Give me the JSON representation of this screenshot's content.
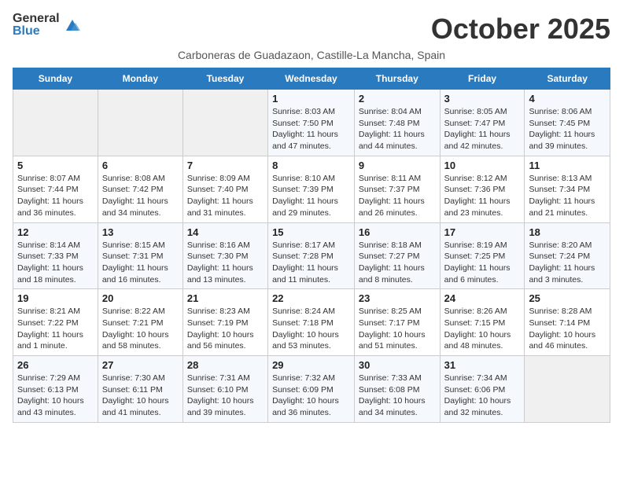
{
  "header": {
    "logo_general": "General",
    "logo_blue": "Blue",
    "month_title": "October 2025",
    "subtitle": "Carboneras de Guadazaon, Castille-La Mancha, Spain"
  },
  "weekdays": [
    "Sunday",
    "Monday",
    "Tuesday",
    "Wednesday",
    "Thursday",
    "Friday",
    "Saturday"
  ],
  "weeks": [
    [
      {
        "day": "",
        "info": ""
      },
      {
        "day": "",
        "info": ""
      },
      {
        "day": "",
        "info": ""
      },
      {
        "day": "1",
        "info": "Sunrise: 8:03 AM\nSunset: 7:50 PM\nDaylight: 11 hours and 47 minutes."
      },
      {
        "day": "2",
        "info": "Sunrise: 8:04 AM\nSunset: 7:48 PM\nDaylight: 11 hours and 44 minutes."
      },
      {
        "day": "3",
        "info": "Sunrise: 8:05 AM\nSunset: 7:47 PM\nDaylight: 11 hours and 42 minutes."
      },
      {
        "day": "4",
        "info": "Sunrise: 8:06 AM\nSunset: 7:45 PM\nDaylight: 11 hours and 39 minutes."
      }
    ],
    [
      {
        "day": "5",
        "info": "Sunrise: 8:07 AM\nSunset: 7:44 PM\nDaylight: 11 hours and 36 minutes."
      },
      {
        "day": "6",
        "info": "Sunrise: 8:08 AM\nSunset: 7:42 PM\nDaylight: 11 hours and 34 minutes."
      },
      {
        "day": "7",
        "info": "Sunrise: 8:09 AM\nSunset: 7:40 PM\nDaylight: 11 hours and 31 minutes."
      },
      {
        "day": "8",
        "info": "Sunrise: 8:10 AM\nSunset: 7:39 PM\nDaylight: 11 hours and 29 minutes."
      },
      {
        "day": "9",
        "info": "Sunrise: 8:11 AM\nSunset: 7:37 PM\nDaylight: 11 hours and 26 minutes."
      },
      {
        "day": "10",
        "info": "Sunrise: 8:12 AM\nSunset: 7:36 PM\nDaylight: 11 hours and 23 minutes."
      },
      {
        "day": "11",
        "info": "Sunrise: 8:13 AM\nSunset: 7:34 PM\nDaylight: 11 hours and 21 minutes."
      }
    ],
    [
      {
        "day": "12",
        "info": "Sunrise: 8:14 AM\nSunset: 7:33 PM\nDaylight: 11 hours and 18 minutes."
      },
      {
        "day": "13",
        "info": "Sunrise: 8:15 AM\nSunset: 7:31 PM\nDaylight: 11 hours and 16 minutes."
      },
      {
        "day": "14",
        "info": "Sunrise: 8:16 AM\nSunset: 7:30 PM\nDaylight: 11 hours and 13 minutes."
      },
      {
        "day": "15",
        "info": "Sunrise: 8:17 AM\nSunset: 7:28 PM\nDaylight: 11 hours and 11 minutes."
      },
      {
        "day": "16",
        "info": "Sunrise: 8:18 AM\nSunset: 7:27 PM\nDaylight: 11 hours and 8 minutes."
      },
      {
        "day": "17",
        "info": "Sunrise: 8:19 AM\nSunset: 7:25 PM\nDaylight: 11 hours and 6 minutes."
      },
      {
        "day": "18",
        "info": "Sunrise: 8:20 AM\nSunset: 7:24 PM\nDaylight: 11 hours and 3 minutes."
      }
    ],
    [
      {
        "day": "19",
        "info": "Sunrise: 8:21 AM\nSunset: 7:22 PM\nDaylight: 11 hours and 1 minute."
      },
      {
        "day": "20",
        "info": "Sunrise: 8:22 AM\nSunset: 7:21 PM\nDaylight: 10 hours and 58 minutes."
      },
      {
        "day": "21",
        "info": "Sunrise: 8:23 AM\nSunset: 7:19 PM\nDaylight: 10 hours and 56 minutes."
      },
      {
        "day": "22",
        "info": "Sunrise: 8:24 AM\nSunset: 7:18 PM\nDaylight: 10 hours and 53 minutes."
      },
      {
        "day": "23",
        "info": "Sunrise: 8:25 AM\nSunset: 7:17 PM\nDaylight: 10 hours and 51 minutes."
      },
      {
        "day": "24",
        "info": "Sunrise: 8:26 AM\nSunset: 7:15 PM\nDaylight: 10 hours and 48 minutes."
      },
      {
        "day": "25",
        "info": "Sunrise: 8:28 AM\nSunset: 7:14 PM\nDaylight: 10 hours and 46 minutes."
      }
    ],
    [
      {
        "day": "26",
        "info": "Sunrise: 7:29 AM\nSunset: 6:13 PM\nDaylight: 10 hours and 43 minutes."
      },
      {
        "day": "27",
        "info": "Sunrise: 7:30 AM\nSunset: 6:11 PM\nDaylight: 10 hours and 41 minutes."
      },
      {
        "day": "28",
        "info": "Sunrise: 7:31 AM\nSunset: 6:10 PM\nDaylight: 10 hours and 39 minutes."
      },
      {
        "day": "29",
        "info": "Sunrise: 7:32 AM\nSunset: 6:09 PM\nDaylight: 10 hours and 36 minutes."
      },
      {
        "day": "30",
        "info": "Sunrise: 7:33 AM\nSunset: 6:08 PM\nDaylight: 10 hours and 34 minutes."
      },
      {
        "day": "31",
        "info": "Sunrise: 7:34 AM\nSunset: 6:06 PM\nDaylight: 10 hours and 32 minutes."
      },
      {
        "day": "",
        "info": ""
      }
    ]
  ]
}
